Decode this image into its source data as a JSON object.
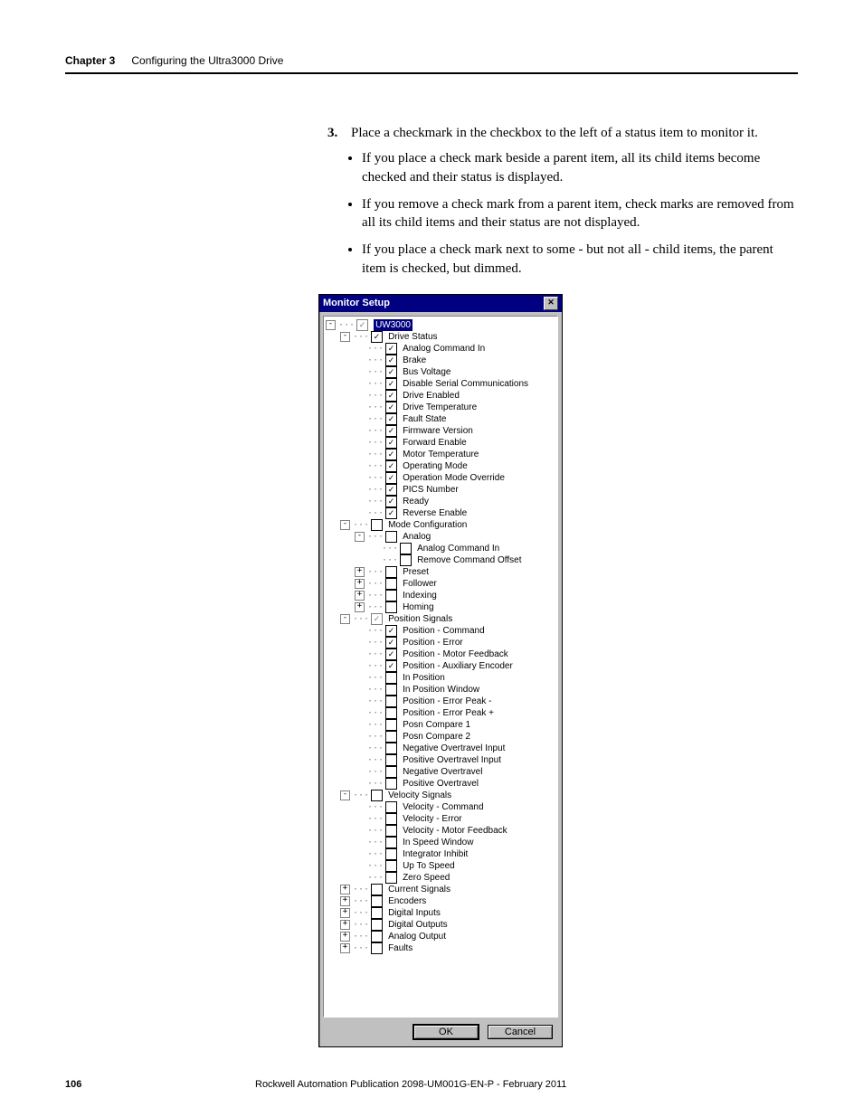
{
  "header": {
    "chapter": "Chapter 3",
    "title": "Configuring the Ultra3000 Drive"
  },
  "step": {
    "number": "3.",
    "text": "Place a checkmark in the checkbox to the left of a status item to monitor it.",
    "bullets": [
      "If you place a check mark beside a parent item, all its child items become checked and their status is displayed.",
      "If you remove a check mark from a parent item, check marks are removed from all its child items and their status are not displayed.",
      "If you place a check mark next to some - but not all - child items, the parent item is checked, but dimmed."
    ]
  },
  "dialog": {
    "title": "Monitor Setup",
    "close_glyph": "✕",
    "ok": "OK",
    "cancel": "Cancel",
    "tree": [
      {
        "indent": 0,
        "exp": "-",
        "check": "dim",
        "label": "UW3000",
        "selected": true
      },
      {
        "indent": 1,
        "exp": "-",
        "check": "on",
        "label": "Drive Status"
      },
      {
        "indent": 2,
        "exp": "",
        "check": "on",
        "label": "Analog Command In"
      },
      {
        "indent": 2,
        "exp": "",
        "check": "on",
        "label": "Brake"
      },
      {
        "indent": 2,
        "exp": "",
        "check": "on",
        "label": "Bus Voltage"
      },
      {
        "indent": 2,
        "exp": "",
        "check": "on",
        "label": "Disable Serial Communications"
      },
      {
        "indent": 2,
        "exp": "",
        "check": "on",
        "label": "Drive Enabled"
      },
      {
        "indent": 2,
        "exp": "",
        "check": "on",
        "label": "Drive Temperature"
      },
      {
        "indent": 2,
        "exp": "",
        "check": "on",
        "label": "Fault State"
      },
      {
        "indent": 2,
        "exp": "",
        "check": "on",
        "label": "Firmware Version"
      },
      {
        "indent": 2,
        "exp": "",
        "check": "on",
        "label": "Forward Enable"
      },
      {
        "indent": 2,
        "exp": "",
        "check": "on",
        "label": "Motor Temperature"
      },
      {
        "indent": 2,
        "exp": "",
        "check": "on",
        "label": "Operating Mode"
      },
      {
        "indent": 2,
        "exp": "",
        "check": "on",
        "label": "Operation Mode Override"
      },
      {
        "indent": 2,
        "exp": "",
        "check": "on",
        "label": "PICS Number"
      },
      {
        "indent": 2,
        "exp": "",
        "check": "on",
        "label": "Ready"
      },
      {
        "indent": 2,
        "exp": "",
        "check": "on",
        "label": "Reverse Enable"
      },
      {
        "indent": 1,
        "exp": "-",
        "check": "off",
        "label": "Mode Configuration"
      },
      {
        "indent": 2,
        "exp": "-",
        "check": "off",
        "label": "Analog"
      },
      {
        "indent": 3,
        "exp": "",
        "check": "off",
        "label": "Analog Command In"
      },
      {
        "indent": 3,
        "exp": "",
        "check": "off",
        "label": "Remove Command Offset"
      },
      {
        "indent": 2,
        "exp": "+",
        "check": "off",
        "label": "Preset"
      },
      {
        "indent": 2,
        "exp": "+",
        "check": "off",
        "label": "Follower"
      },
      {
        "indent": 2,
        "exp": "+",
        "check": "off",
        "label": "Indexing"
      },
      {
        "indent": 2,
        "exp": "+",
        "check": "off",
        "label": "Homing"
      },
      {
        "indent": 1,
        "exp": "-",
        "check": "dim",
        "label": "Position Signals"
      },
      {
        "indent": 2,
        "exp": "",
        "check": "on",
        "label": "Position - Command"
      },
      {
        "indent": 2,
        "exp": "",
        "check": "on",
        "label": "Position - Error"
      },
      {
        "indent": 2,
        "exp": "",
        "check": "on",
        "label": "Position - Motor Feedback"
      },
      {
        "indent": 2,
        "exp": "",
        "check": "on",
        "label": "Position - Auxiliary Encoder"
      },
      {
        "indent": 2,
        "exp": "",
        "check": "off",
        "label": "In Position"
      },
      {
        "indent": 2,
        "exp": "",
        "check": "off",
        "label": "In Position Window"
      },
      {
        "indent": 2,
        "exp": "",
        "check": "off",
        "label": "Position - Error Peak -"
      },
      {
        "indent": 2,
        "exp": "",
        "check": "off",
        "label": "Position - Error Peak +"
      },
      {
        "indent": 2,
        "exp": "",
        "check": "off",
        "label": "Posn Compare 1"
      },
      {
        "indent": 2,
        "exp": "",
        "check": "off",
        "label": "Posn Compare 2"
      },
      {
        "indent": 2,
        "exp": "",
        "check": "off",
        "label": "Negative Overtravel Input"
      },
      {
        "indent": 2,
        "exp": "",
        "check": "off",
        "label": "Positive Overtravel Input"
      },
      {
        "indent": 2,
        "exp": "",
        "check": "off",
        "label": "Negative Overtravel"
      },
      {
        "indent": 2,
        "exp": "",
        "check": "off",
        "label": "Positive Overtravel"
      },
      {
        "indent": 1,
        "exp": "-",
        "check": "off",
        "label": "Velocity Signals"
      },
      {
        "indent": 2,
        "exp": "",
        "check": "off",
        "label": "Velocity - Command"
      },
      {
        "indent": 2,
        "exp": "",
        "check": "off",
        "label": "Velocity - Error"
      },
      {
        "indent": 2,
        "exp": "",
        "check": "off",
        "label": "Velocity - Motor Feedback"
      },
      {
        "indent": 2,
        "exp": "",
        "check": "off",
        "label": "In Speed Window"
      },
      {
        "indent": 2,
        "exp": "",
        "check": "off",
        "label": "Integrator Inhibit"
      },
      {
        "indent": 2,
        "exp": "",
        "check": "off",
        "label": "Up To Speed"
      },
      {
        "indent": 2,
        "exp": "",
        "check": "off",
        "label": "Zero Speed"
      },
      {
        "indent": 1,
        "exp": "+",
        "check": "off",
        "label": "Current Signals"
      },
      {
        "indent": 1,
        "exp": "+",
        "check": "off",
        "label": "Encoders"
      },
      {
        "indent": 1,
        "exp": "+",
        "check": "off",
        "label": "Digital Inputs"
      },
      {
        "indent": 1,
        "exp": "+",
        "check": "off",
        "label": "Digital Outputs"
      },
      {
        "indent": 1,
        "exp": "+",
        "check": "off",
        "label": "Analog Output"
      },
      {
        "indent": 1,
        "exp": "+",
        "check": "off",
        "label": "Faults"
      }
    ]
  },
  "footer": {
    "page": "106",
    "pub": "Rockwell Automation Publication 2098-UM001G-EN-P  - February 2011"
  }
}
